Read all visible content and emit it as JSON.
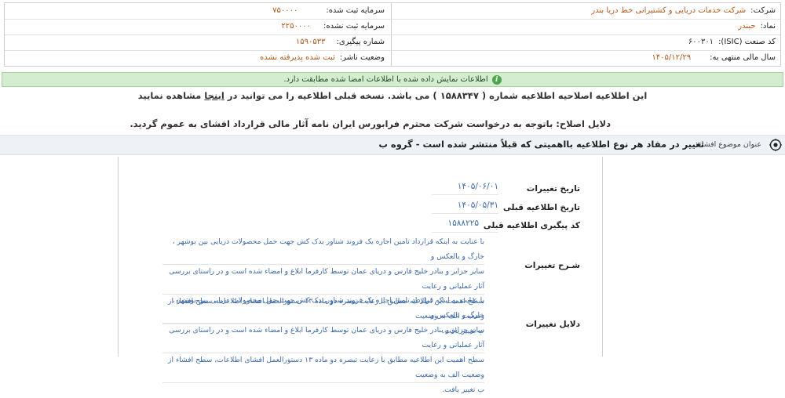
{
  "info": {
    "company_label": "شرکت:",
    "company_value": "شرکت خدمات دریایی و کشتیرانی خط دریا بندر",
    "registered_capital_label": "سرمایه ثبت شده:",
    "registered_capital_value": "۷۵۰۰۰۰",
    "symbol_label": "نماد:",
    "symbol_value": "حبندر",
    "unregistered_capital_label": "سرمایه ثبت نشده:",
    "unregistered_capital_value": "۲۲۵۰۰۰۰",
    "isic_label": "کد صنعت (ISIC):",
    "isic_value": "۶۰۰۳۰۱",
    "tracking_label": "شماره پیگیری:",
    "tracking_value": "۱۵۹۰۵۳۳",
    "fiscal_year_label": "سال مالی منتهی به:",
    "fiscal_year_value": "۱۴۰۵/۱۲/۲۹",
    "publisher_status_label": "وضعیت ناشر:",
    "publisher_status_value": "ثبت شده پذیرفته نشده"
  },
  "banner": {
    "text": "اطلاعات نمایش داده شده با اطلاعات امضا شده مطابقت دارد."
  },
  "correction_notice": {
    "before": "این اطلاعیه اصلاحیه اطلاعیه شماره ( ۱۵۸۸۳۴۷ ) می باشد. نسخه قبلی اطلاعیه را می توانید در",
    "link": "اینجا",
    "after": "مشاهده نمایید"
  },
  "correction_reason": "دلایل اصلاح: باتوجه به درخواست شرکت محترم فرابورس ایران نامه آثار مالی قرارداد افشای به عموم گردید.",
  "subject": {
    "label": "عنوان موضوع افشاء:",
    "value": "تغییر در مفاد هر نوع اطلاعیه بااهمیتی که قبلاً منتشر شده است - گروه ب"
  },
  "fields": {
    "change_date_label": "تاریخ تغییرات",
    "change_date_value": "۱۴۰۵/۰۶/۰۱",
    "prev_date_label": "تاریخ اطلاعیه قبلی",
    "prev_date_value": "۱۴۰۵/۰۵/۳۱",
    "prev_tracking_label": "کد پیگیری اطلاعیه قبلی",
    "prev_tracking_value": "۱۵۸۸۲۲۵",
    "description_label": "شـرح تغییرات",
    "description_lines": [
      "با عنایت به اینکه قرارداد تامین اجاره یک فروند شناور یدک کش جهت حمل محصولات دریایی بین بوشهر ، خارگ و بالعکس و",
      "سایر جزایر و بنادر خلیج فارس و دریای عمان توسط کارفرما ابلاغ و امضاء شده است و در راستای بررسی آثار عملیاتی و رعایت",
      "سطح اهمیت این اطلاعیه مطابق با رعایت تبصره دو ماده ۱۳ دستورالعمل افشای اطلاعات، سطح افشاء از وضعیت الف به وضعیت",
      "ب تغییر یافت."
    ],
    "reasons_label": "دلایل تغییرات",
    "reasons_lines": [
      "با عنایت به اینکه قرارداد تامین اجاره یک فروند شناور یدک کش جهت حمل محصولات دریایی بین بوشهر ، خارگ و بالعکس و",
      "سایر جزایر و بنادر خلیج فارس و دریای عمان توسط کارفرما ابلاغ و امضاء شده است و در راستای بررسی آثار عملیاتی و رعایت",
      "سطح اهمیت این اطلاعیه مطابق با رعایت تبصره دو ماده ۱۳ دستورالعمل افشای اطلاعات، سطح افشاء از وضعیت الف به وضعیت",
      "ب تغییر یافت."
    ]
  },
  "colors": {
    "value_orange": "#b35a1f",
    "value_blue": "#3d6aa8",
    "banner_green": "#d4ecd0",
    "subject_bg": "#eef2f7"
  }
}
